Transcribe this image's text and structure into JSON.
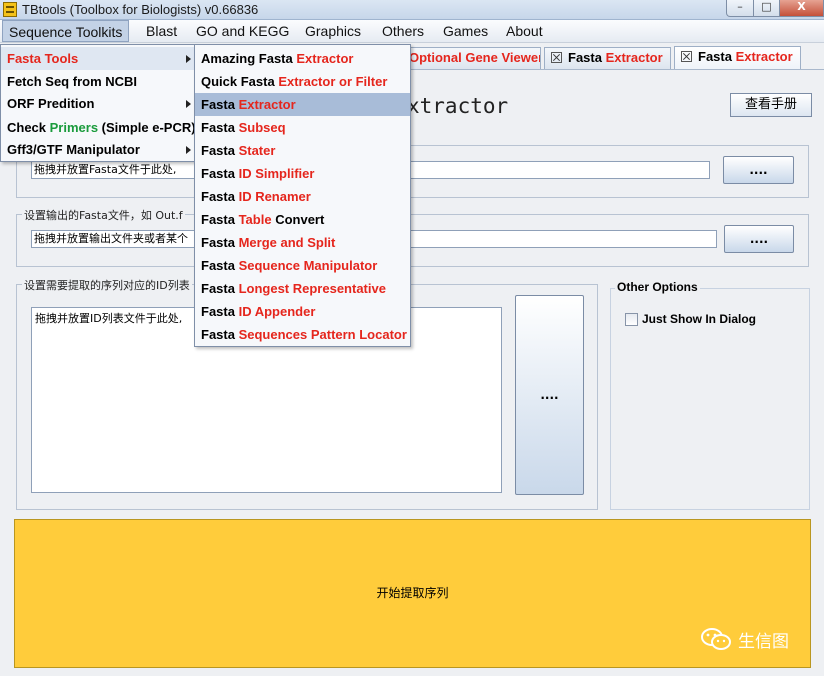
{
  "window": {
    "title": "TBtools (Toolbox for Biologists) v0.66836",
    "minimize": "–",
    "maximize": "□",
    "close": "X"
  },
  "menubar": [
    "Sequence Toolkits",
    "Blast",
    "GO and KEGG",
    "Graphics",
    "Others",
    "Games",
    "About"
  ],
  "tabs": [
    {
      "prefix": "",
      "label": "Optional Gene Viewer"
    },
    {
      "prefix": "Fasta ",
      "label": "Extractor"
    },
    {
      "prefix": "Fasta ",
      "label": "Extractor"
    }
  ],
  "main": {
    "title": "xtractor",
    "manual_button": "查看手册",
    "input_fasta": {
      "value": "拖拽并放置Fasta文件于此处,",
      "button": "...."
    },
    "output_fasta": {
      "label": "设置输出的Fasta文件，如 Out.f",
      "value": "拖拽并放置输出文件夹或者某个",
      "button": "...."
    },
    "id_list": {
      "label": "设置需要提取的序列对应的ID列表",
      "value": "拖拽并放置ID列表文件于此处,",
      "button": "...."
    },
    "options": {
      "label": "Other Options",
      "checkbox_label": "Just Show In Dialog"
    },
    "start_button": "开始提取序列",
    "watermark": "生信图"
  },
  "sequence_menu": [
    {
      "parts": [
        {
          "t": "Fasta Tools",
          "c": "red"
        }
      ],
      "submenu": true
    },
    {
      "parts": [
        {
          "t": "Fetch Seq from NCBI",
          "c": ""
        }
      ],
      "submenu": false
    },
    {
      "parts": [
        {
          "t": "ORF Predition",
          "c": ""
        }
      ],
      "submenu": true
    },
    {
      "parts": [
        {
          "t": "Check ",
          "c": ""
        },
        {
          "t": "Primers",
          "c": "green"
        },
        {
          "t": " (Simple e-PCR)",
          "c": ""
        }
      ],
      "submenu": false
    },
    {
      "parts": [
        {
          "t": "Gff3/GTF Manipulator",
          "c": ""
        }
      ],
      "submenu": true
    }
  ],
  "fasta_menu": [
    {
      "parts": [
        {
          "t": "Amazing Fasta ",
          "c": ""
        },
        {
          "t": "Extractor",
          "c": "red"
        }
      ]
    },
    {
      "parts": [
        {
          "t": "Quick Fasta ",
          "c": ""
        },
        {
          "t": "Extractor or Filter",
          "c": "red"
        }
      ]
    },
    {
      "parts": [
        {
          "t": "Fasta ",
          "c": ""
        },
        {
          "t": "Extractor",
          "c": "red"
        }
      ]
    },
    {
      "parts": [
        {
          "t": "Fasta ",
          "c": ""
        },
        {
          "t": "Subseq",
          "c": "red"
        }
      ]
    },
    {
      "parts": [
        {
          "t": "Fasta ",
          "c": ""
        },
        {
          "t": "Stater",
          "c": "red"
        }
      ]
    },
    {
      "parts": [
        {
          "t": "Fasta ",
          "c": ""
        },
        {
          "t": "ID Simplifier",
          "c": "red"
        }
      ]
    },
    {
      "parts": [
        {
          "t": "Fasta ",
          "c": ""
        },
        {
          "t": "ID Renamer",
          "c": "red"
        }
      ]
    },
    {
      "parts": [
        {
          "t": "Fasta ",
          "c": ""
        },
        {
          "t": "Table",
          "c": "red"
        },
        {
          "t": " Convert",
          "c": ""
        }
      ]
    },
    {
      "parts": [
        {
          "t": "Fasta ",
          "c": ""
        },
        {
          "t": "Merge and Split",
          "c": "red"
        }
      ]
    },
    {
      "parts": [
        {
          "t": "Fasta ",
          "c": ""
        },
        {
          "t": "Sequence Manipulator",
          "c": "red"
        }
      ]
    },
    {
      "parts": [
        {
          "t": "Fasta ",
          "c": ""
        },
        {
          "t": "Longest Representative",
          "c": "red"
        }
      ]
    },
    {
      "parts": [
        {
          "t": "Fasta ",
          "c": ""
        },
        {
          "t": "ID Appender",
          "c": "red"
        }
      ]
    },
    {
      "parts": [
        {
          "t": "Fasta ",
          "c": ""
        },
        {
          "t": "Sequences Pattern Locator",
          "c": "red"
        }
      ]
    }
  ],
  "colors": {
    "accent_red": "#e5261d",
    "accent_green": "#1a9b3c",
    "start_button": "#ffcc3b",
    "highlight": "#a8bcd8"
  },
  "icons": [
    "app-icon",
    "close-icon",
    "minimize-icon",
    "maximize-icon",
    "submenu-arrow-icon",
    "wechat-icon"
  ]
}
